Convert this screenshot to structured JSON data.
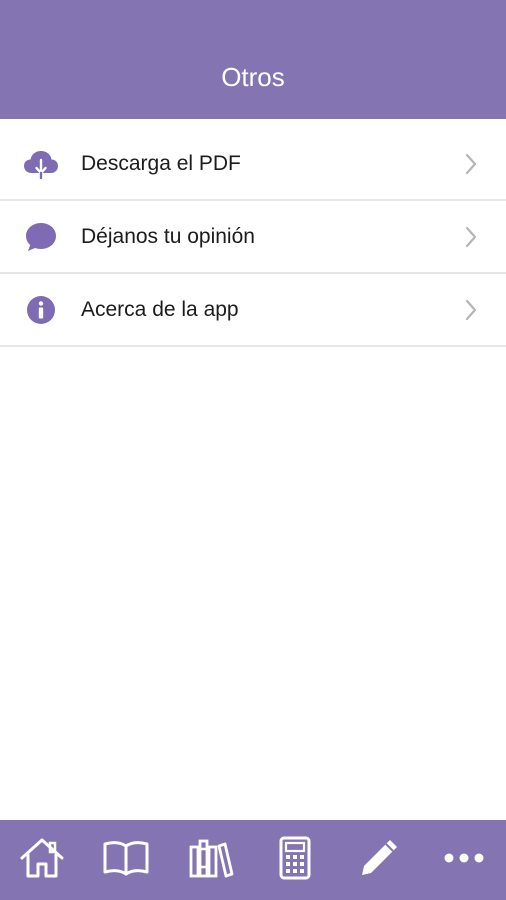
{
  "header": {
    "title": "Otros"
  },
  "menu": {
    "items": [
      {
        "label": "Descarga el PDF",
        "icon": "cloud-download-icon"
      },
      {
        "label": "Déjanos tu opinión",
        "icon": "chat-bubble-icon"
      },
      {
        "label": "Acerca de la app",
        "icon": "info-icon"
      }
    ]
  },
  "tabbar": {
    "tabs": [
      {
        "icon": "home-icon"
      },
      {
        "icon": "open-book-icon"
      },
      {
        "icon": "bookshelf-icon"
      },
      {
        "icon": "calculator-icon"
      },
      {
        "icon": "pencil-icon"
      },
      {
        "icon": "more-icon"
      }
    ]
  },
  "colors": {
    "accent": "#8474b2",
    "icon": "#7f6bb3",
    "divider": "#e7e5ea",
    "chevron": "#b5b5b5"
  }
}
